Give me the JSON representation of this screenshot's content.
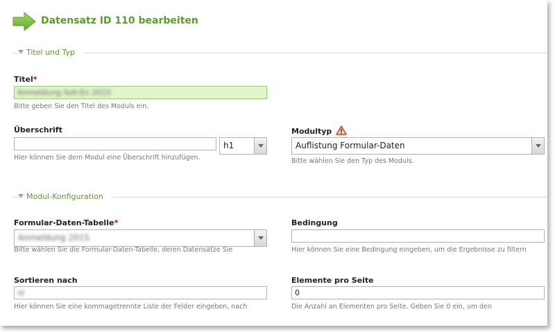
{
  "header": {
    "title": "Datensatz ID 110 bearbeiten"
  },
  "sections": {
    "titel_typ": "Titel und Typ",
    "modul_konfig": "Modul-Konfiguration"
  },
  "fields": {
    "titel": {
      "label": "Titel",
      "required": "*",
      "value": "Anmeldung Soll-Ex 2015",
      "help": "Bitte geben Sie den Titel des Moduls ein."
    },
    "ueberschrift": {
      "label": "Überschrift",
      "value": "",
      "help": "Hier können Sie dem Modul eine Überschrift hinzufügen.",
      "select_value": "h1"
    },
    "modultyp": {
      "label": "Modultyp",
      "value": "Auflistung Formular-Daten",
      "help": "Bitte wählen Sie den Typ des Moduls."
    },
    "formular_tabelle": {
      "label": "Formular-Daten-Tabelle",
      "required": "*",
      "value": "Anmeldung 2015",
      "help": "Bitte wählen Sie die Formular-Daten-Tabelle, deren Datensätze Sie"
    },
    "bedingung": {
      "label": "Bedingung",
      "value": "",
      "help": "Hier können Sie eine Bedingung eingeben, um die Ergebnisse zu filtern"
    },
    "sortieren": {
      "label": "Sortieren nach",
      "value": "id",
      "help": "Hier können Sie eine kommagetrennte Liste der Felder eingeben, nach"
    },
    "elemente": {
      "label": "Elemente pro Seite",
      "value": "0",
      "help": "Die Anzahl an Elementen pro Seite. Geben Sie 0 ein, um den"
    }
  },
  "icons": {
    "header_arrow": "green-arrow-icon",
    "warning": "warning-icon",
    "collapse": "collapse-triangle-icon"
  },
  "colors": {
    "accent": "#5a9e2b",
    "required": "#cc0000",
    "valid_bg": "#e1f5c8"
  }
}
